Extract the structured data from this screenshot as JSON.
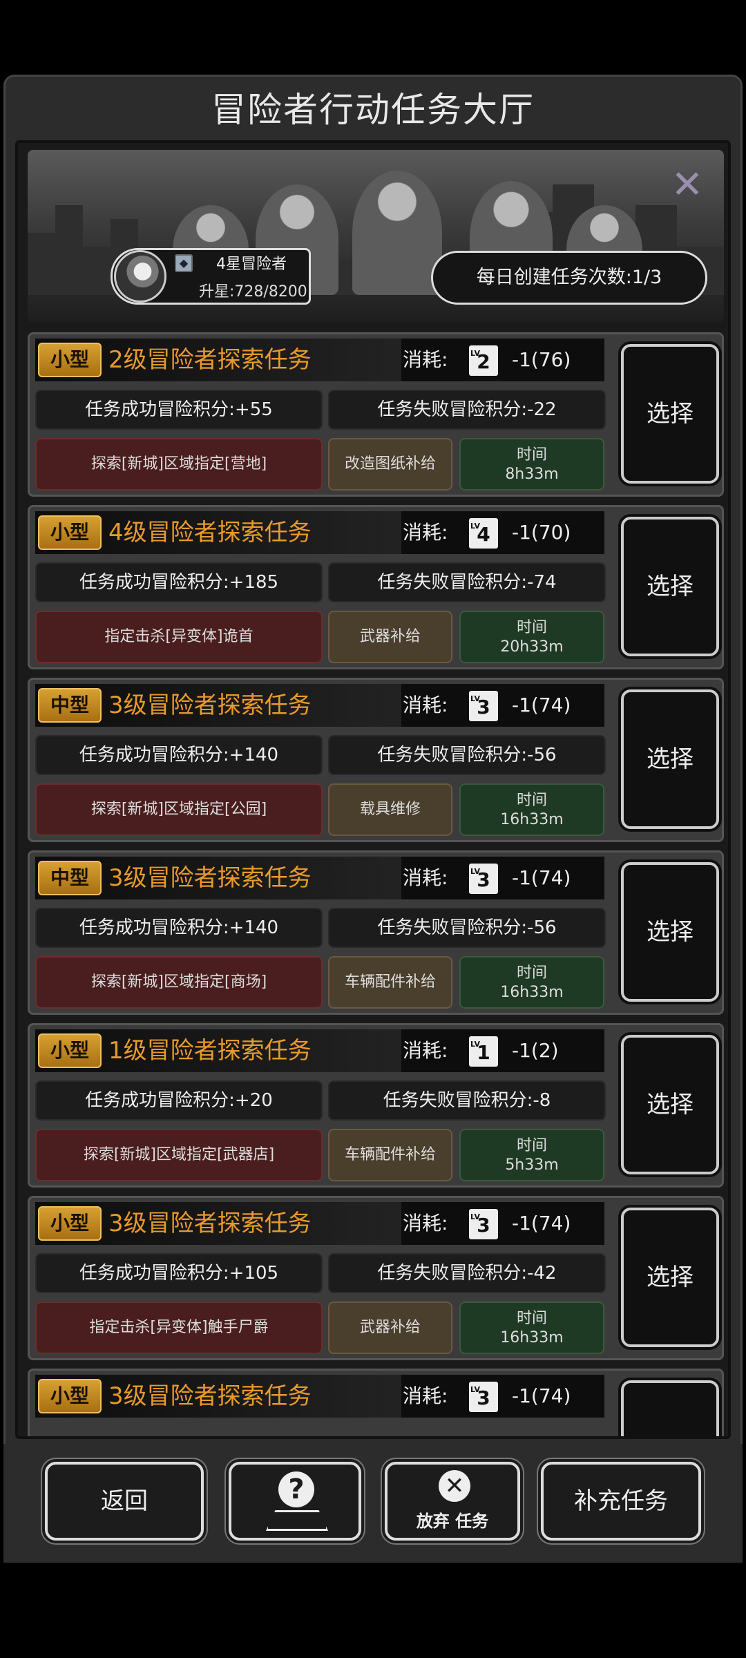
{
  "header": {
    "title": "冒险者行动任务大厅"
  },
  "player": {
    "rank": "4星冒险者",
    "upgrade": "升星:728/8200"
  },
  "daily": {
    "label": "每日创建任务次数:1/3"
  },
  "colors": {
    "title_orange": "#e89a2c",
    "badge_gold": "#d6a032",
    "target_red": "#4a1e1e",
    "reward_brown": "#4a3e2c",
    "time_green": "#1f3a24"
  },
  "tasks": [
    {
      "size": "小型",
      "title": "2级冒险者探索任务",
      "cost_label": "消耗:",
      "cost_level": "2",
      "cost": "-1(76)",
      "success": "任务成功冒险积分:+55",
      "fail": "任务失败冒险积分:-22",
      "target": "探索[新城]区域指定[营地]",
      "reward": "改造图纸补给",
      "time_label": "时间",
      "time": "8h33m",
      "select": "选择"
    },
    {
      "size": "小型",
      "title": "4级冒险者探索任务",
      "cost_label": "消耗:",
      "cost_level": "4",
      "cost": "-1(70)",
      "success": "任务成功冒险积分:+185",
      "fail": "任务失败冒险积分:-74",
      "target": "指定击杀[异变体]诡首",
      "reward": "武器补给",
      "time_label": "时间",
      "time": "20h33m",
      "select": "选择"
    },
    {
      "size": "中型",
      "title": "3级冒险者探索任务",
      "cost_label": "消耗:",
      "cost_level": "3",
      "cost": "-1(74)",
      "success": "任务成功冒险积分:+140",
      "fail": "任务失败冒险积分:-56",
      "target": "探索[新城]区域指定[公园]",
      "reward": "载具维修",
      "time_label": "时间",
      "time": "16h33m",
      "select": "选择"
    },
    {
      "size": "中型",
      "title": "3级冒险者探索任务",
      "cost_label": "消耗:",
      "cost_level": "3",
      "cost": "-1(74)",
      "success": "任务成功冒险积分:+140",
      "fail": "任务失败冒险积分:-56",
      "target": "探索[新城]区域指定[商场]",
      "reward": "车辆配件补给",
      "time_label": "时间",
      "time": "16h33m",
      "select": "选择"
    },
    {
      "size": "小型",
      "title": "1级冒险者探索任务",
      "cost_label": "消耗:",
      "cost_level": "1",
      "cost": "-1(2)",
      "success": "任务成功冒险积分:+20",
      "fail": "任务失败冒险积分:-8",
      "target": "探索[新城]区域指定[武器店]",
      "reward": "车辆配件补给",
      "time_label": "时间",
      "time": "5h33m",
      "select": "选择"
    },
    {
      "size": "小型",
      "title": "3级冒险者探索任务",
      "cost_label": "消耗:",
      "cost_level": "3",
      "cost": "-1(74)",
      "success": "任务成功冒险积分:+105",
      "fail": "任务失败冒险积分:-42",
      "target": "指定击杀[异变体]触手尸爵",
      "reward": "武器补给",
      "time_label": "时间",
      "time": "16h33m",
      "select": "选择"
    },
    {
      "size": "小型",
      "title": "3级冒险者探索任务",
      "cost_label": "消耗:",
      "cost_level": "3",
      "cost": "-1(74)",
      "success": "",
      "fail": "",
      "target": "",
      "reward": "",
      "time_label": "",
      "time": "",
      "select": ""
    }
  ],
  "footer": {
    "back": "返回",
    "help_icon": "question-icon",
    "abandon_icon": "close-icon",
    "abandon": "放弃 任务",
    "supply": "补充任务"
  }
}
